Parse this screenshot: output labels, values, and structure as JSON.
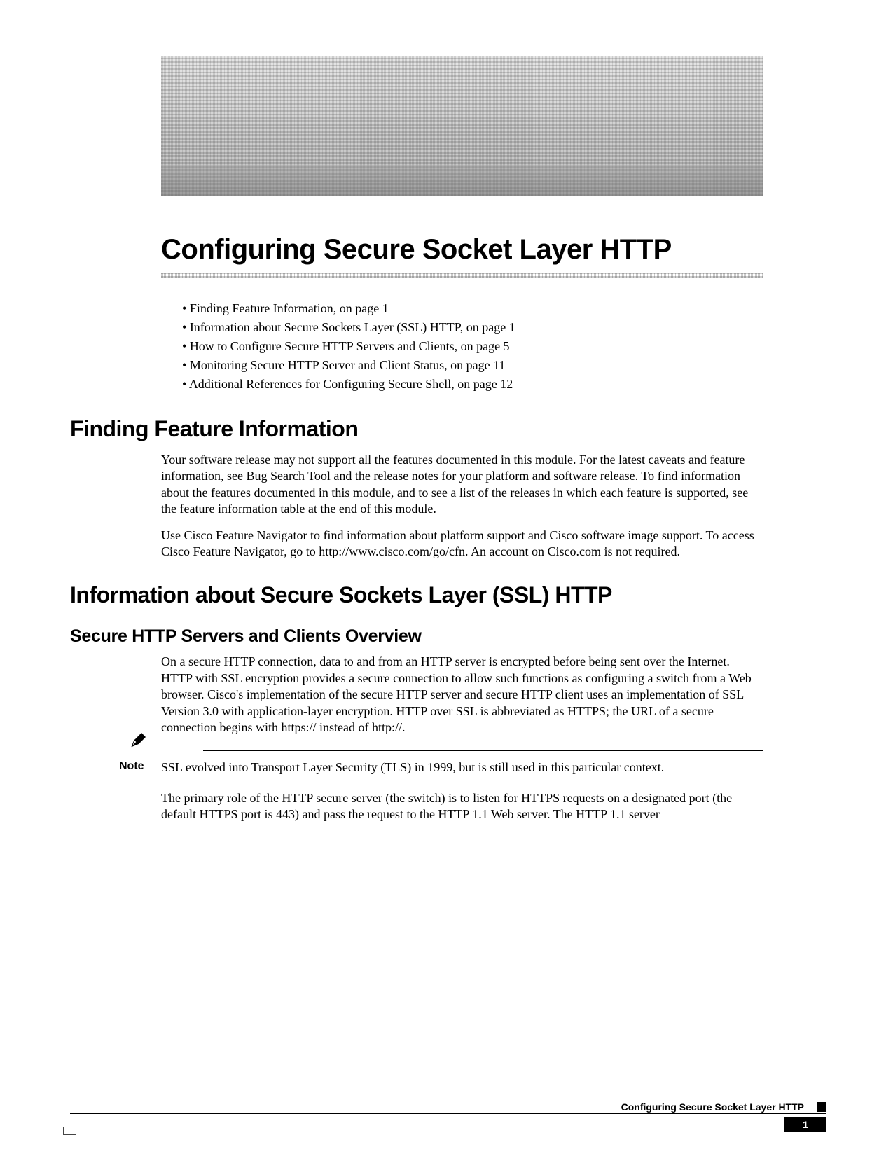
{
  "chapter": {
    "title": "Configuring Secure Socket Layer HTTP"
  },
  "toc": [
    "Finding Feature Information, on page 1",
    "Information about Secure Sockets Layer (SSL) HTTP, on page 1",
    "How to Configure Secure HTTP Servers and Clients, on page 5",
    "Monitoring Secure HTTP Server and Client Status, on page 11",
    "Additional References for Configuring Secure Shell, on page 12"
  ],
  "sections": {
    "finding": {
      "heading": "Finding Feature Information",
      "paras": [
        "Your software release may not support all the features documented in this module. For the latest caveats and feature information, see Bug Search Tool and the release notes for your platform and software release. To find information about the features documented in this module, and to see a list of the releases in which each feature is supported, see the feature information table at the end of this module.",
        "Use Cisco Feature Navigator to find information about platform support and Cisco software image support. To access Cisco Feature Navigator, go to http://www.cisco.com/go/cfn. An account on Cisco.com is not required."
      ]
    },
    "ssl": {
      "heading": "Information about Secure Sockets Layer (SSL) HTTP",
      "sub": {
        "heading": "Secure HTTP Servers and Clients Overview",
        "paras": [
          "On a secure HTTP connection, data to and from an HTTP server is encrypted before being sent over the Internet. HTTP with SSL encryption provides a secure connection to allow such functions as configuring a switch from a Web browser. Cisco's implementation of the secure HTTP server and secure HTTP client uses an implementation of SSL Version 3.0 with application-layer encryption. HTTP over SSL is abbreviated as HTTPS; the URL of a secure connection begins with https:// instead of http://."
        ],
        "note": {
          "label": "Note",
          "text": "SSL evolved into Transport Layer Security (TLS) in 1999, but is still used in this particular context."
        },
        "paras_after": [
          "The primary role of the HTTP secure server (the switch) is to listen for HTTPS requests on a designated port (the default HTTPS port is 443) and pass the request to the HTTP 1.1 Web server. The HTTP 1.1 server"
        ]
      }
    }
  },
  "footer": {
    "title": "Configuring Secure Socket Layer HTTP",
    "page": "1"
  }
}
